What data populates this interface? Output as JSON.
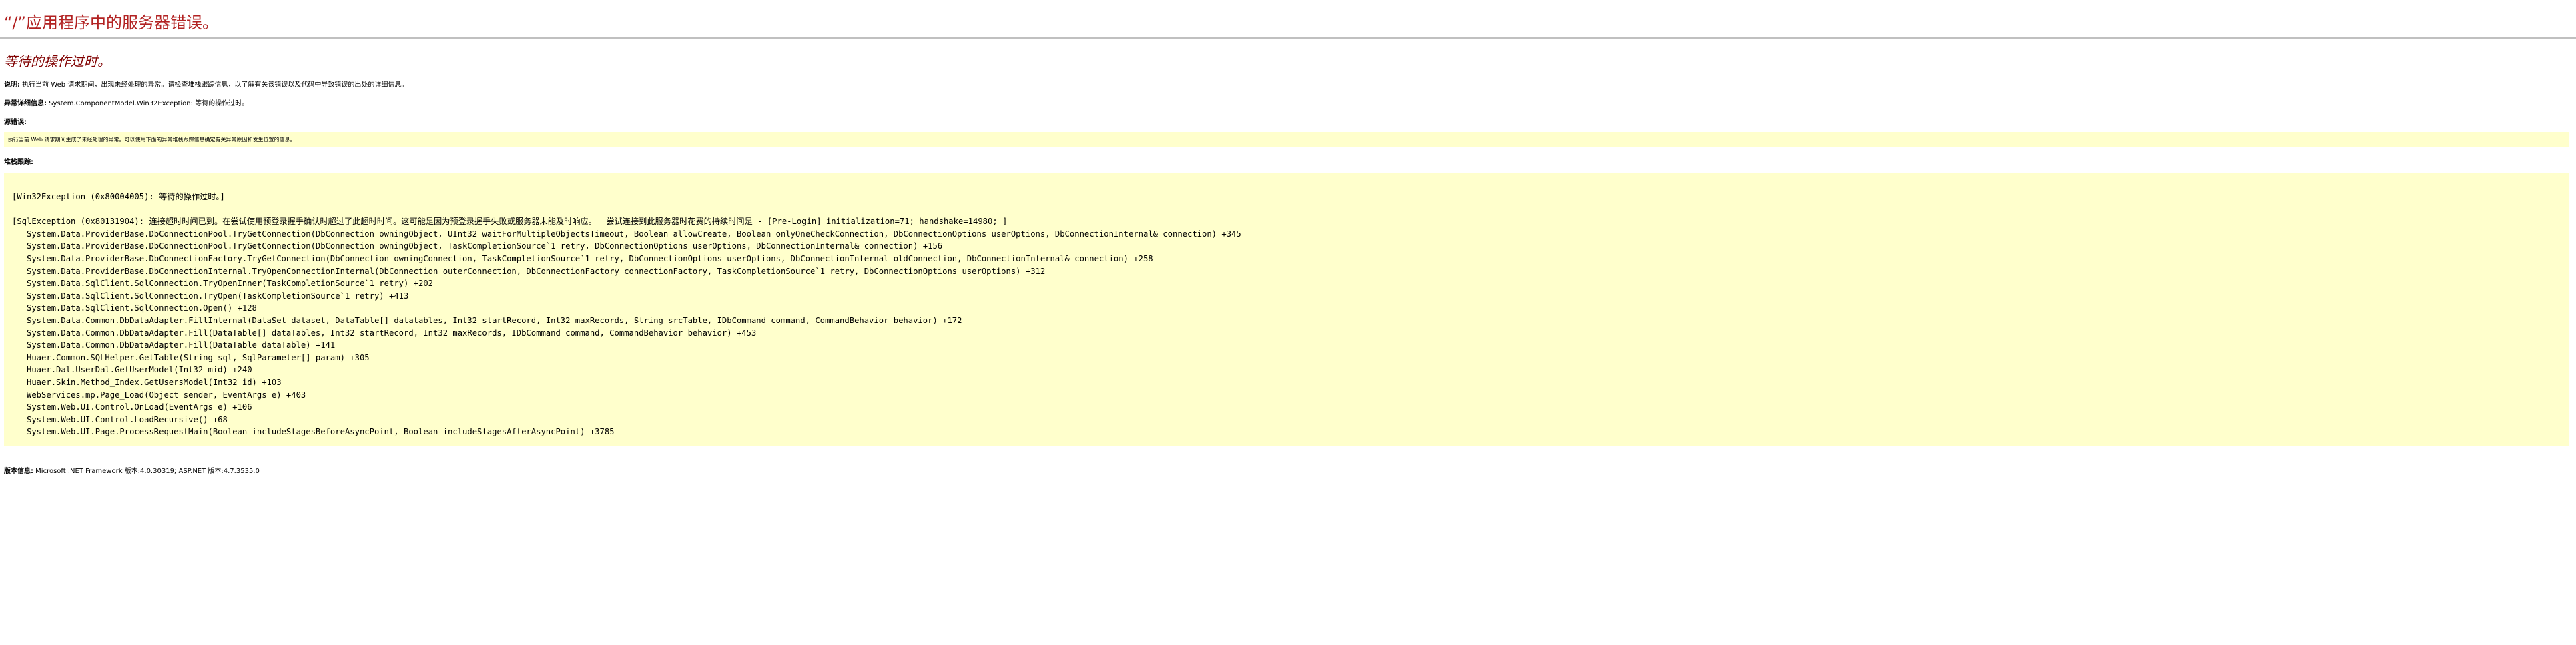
{
  "page": {
    "title": "“/”应用程序中的服务器错误。",
    "subtitle": "等待的操作过时。"
  },
  "description": {
    "label": "说明:",
    "text": " 执行当前 Web 请求期间，出现未经处理的异常。请检查堆栈跟踪信息，以了解有关该错误以及代码中导致错误的出处的详细信息。"
  },
  "exception_details": {
    "label": "异常详细信息:",
    "text": " System.ComponentModel.Win32Exception: 等待的操作过时。"
  },
  "source_error": {
    "label": "源错误:",
    "text": "执行当前 Web 请求期间生成了未经处理的异常。可以使用下面的异常堆栈跟踪信息确定有关异常原因和发生位置的信息。"
  },
  "stack_trace": {
    "label": "堆栈跟踪:",
    "lines": [
      "[Win32Exception (0x80004005): 等待的操作过时。]",
      "",
      "[SqlException (0x80131904): 连接超时时间已到。在尝试使用预登录握手确认时超过了此超时时间。这可能是因为预登录握手失败或服务器未能及时响应。  尝试连接到此服务器时花费的持续时间是 - [Pre-Login] initialization=71; handshake=14980; ]",
      "   System.Data.ProviderBase.DbConnectionPool.TryGetConnection(DbConnection owningObject, UInt32 waitForMultipleObjectsTimeout, Boolean allowCreate, Boolean onlyOneCheckConnection, DbConnectionOptions userOptions, DbConnectionInternal& connection) +345",
      "   System.Data.ProviderBase.DbConnectionPool.TryGetConnection(DbConnection owningObject, TaskCompletionSource`1 retry, DbConnectionOptions userOptions, DbConnectionInternal& connection) +156",
      "   System.Data.ProviderBase.DbConnectionFactory.TryGetConnection(DbConnection owningConnection, TaskCompletionSource`1 retry, DbConnectionOptions userOptions, DbConnectionInternal oldConnection, DbConnectionInternal& connection) +258",
      "   System.Data.ProviderBase.DbConnectionInternal.TryOpenConnectionInternal(DbConnection outerConnection, DbConnectionFactory connectionFactory, TaskCompletionSource`1 retry, DbConnectionOptions userOptions) +312",
      "   System.Data.SqlClient.SqlConnection.TryOpenInner(TaskCompletionSource`1 retry) +202",
      "   System.Data.SqlClient.SqlConnection.TryOpen(TaskCompletionSource`1 retry) +413",
      "   System.Data.SqlClient.SqlConnection.Open() +128",
      "   System.Data.Common.DbDataAdapter.FillInternal(DataSet dataset, DataTable[] datatables, Int32 startRecord, Int32 maxRecords, String srcTable, IDbCommand command, CommandBehavior behavior) +172",
      "   System.Data.Common.DbDataAdapter.Fill(DataTable[] dataTables, Int32 startRecord, Int32 maxRecords, IDbCommand command, CommandBehavior behavior) +453",
      "   System.Data.Common.DbDataAdapter.Fill(DataTable dataTable) +141",
      "   Huaer.Common.SQLHelper.GetTable(String sql, SqlParameter[] param) +305",
      "   Huaer.Dal.UserDal.GetUserModel(Int32 mid) +240",
      "   Huaer.Skin.Method_Index.GetUsersModel(Int32 id) +103",
      "   WebServices.mp.Page_Load(Object sender, EventArgs e) +403",
      "   System.Web.UI.Control.OnLoad(EventArgs e) +106",
      "   System.Web.UI.Control.LoadRecursive() +68",
      "   System.Web.UI.Page.ProcessRequestMain(Boolean includeStagesBeforeAsyncPoint, Boolean includeStagesAfterAsyncPoint) +3785"
    ]
  },
  "version_info": {
    "label": "版本信息:",
    "text": " Microsoft .NET Framework 版本:4.0.30319; ASP.NET 版本:4.7.3535.0"
  },
  "colors": {
    "title": "#b22222",
    "subtitle": "#800000",
    "code_background": "#ffffcc",
    "rule": "#c0c0c0"
  }
}
